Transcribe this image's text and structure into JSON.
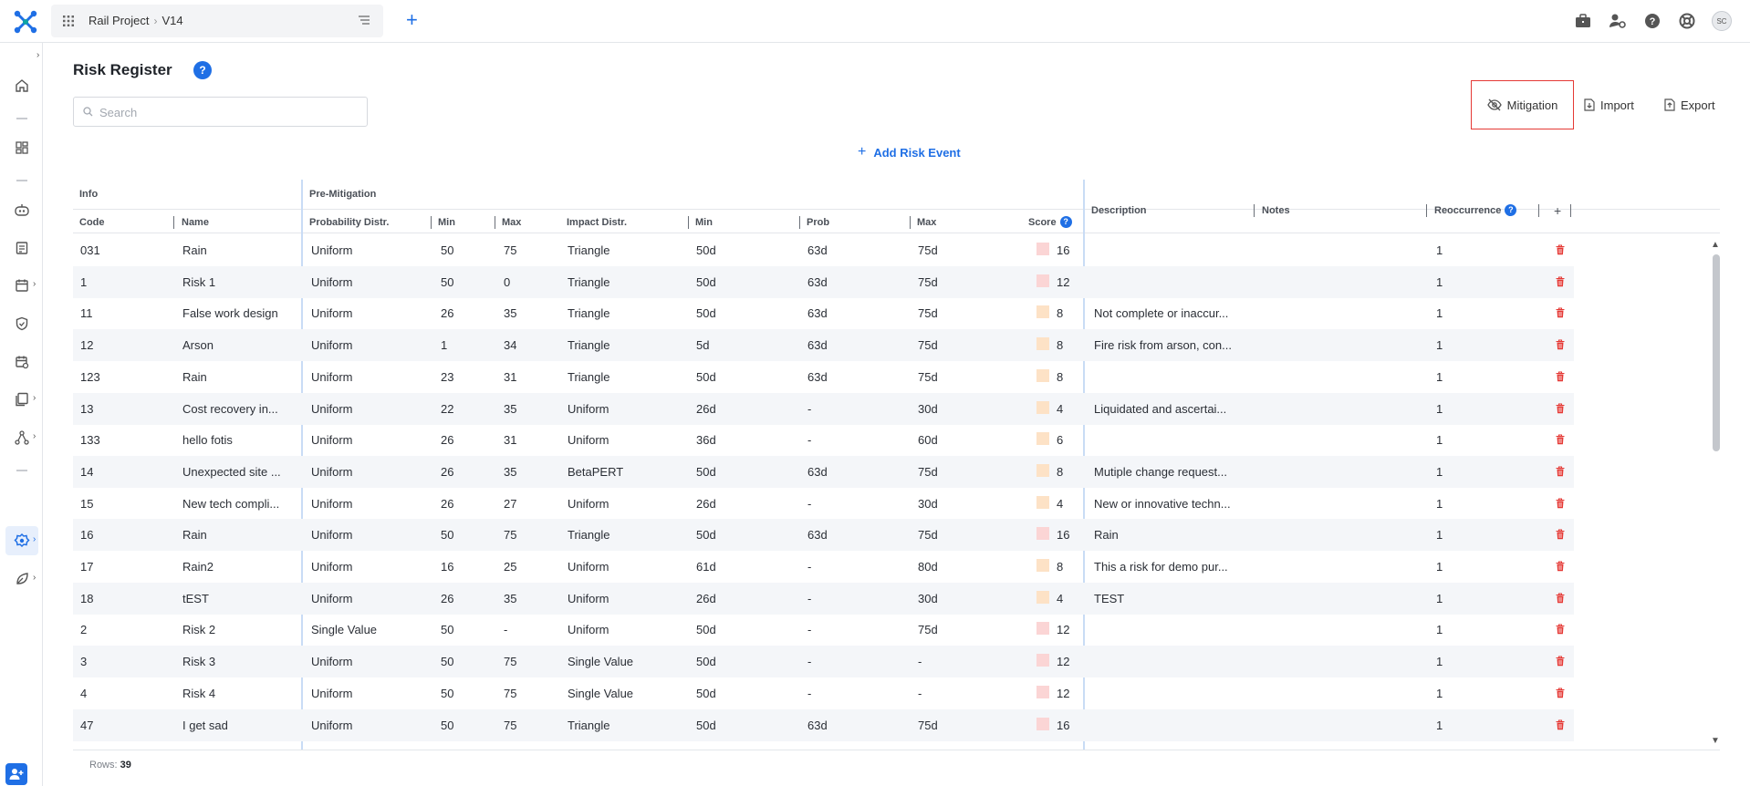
{
  "topbar": {
    "project": "Rail Project",
    "version": "V14",
    "avatar_initials": "SC"
  },
  "page": {
    "title": "Risk Register",
    "help_label": "?",
    "search_placeholder": "Search"
  },
  "actions": {
    "mitigation": "Mitigation",
    "import": "Import",
    "export": "Export",
    "add_risk": "Add Risk Event"
  },
  "table": {
    "group_info": "Info",
    "group_pre": "Pre-Mitigation",
    "columns": {
      "code": "Code",
      "name": "Name",
      "prob_distr": "Probability Distr.",
      "min1": "Min",
      "max1": "Max",
      "impact_distr": "Impact Distr.",
      "min2": "Min",
      "prob": "Prob",
      "max2": "Max",
      "score": "Score",
      "score_help": "?",
      "description": "Description",
      "notes": "Notes",
      "reoccurrence": "Reoccurrence",
      "reoccurrence_help": "?",
      "add_col": "+"
    },
    "rows": [
      {
        "code": "031",
        "name": "Rain",
        "pd": "Uniform",
        "min1": "50",
        "max1": "75",
        "id": "Triangle",
        "min2": "50d",
        "prob": "63d",
        "max2": "75d",
        "score": "16",
        "level": "high",
        "desc": "",
        "notes": "",
        "reocc": "1"
      },
      {
        "code": "1",
        "name": "Risk 1",
        "pd": "Uniform",
        "min1": "50",
        "max1": "0",
        "id": "Triangle",
        "min2": "50d",
        "prob": "63d",
        "max2": "75d",
        "score": "12",
        "level": "high",
        "desc": "",
        "notes": "",
        "reocc": "1"
      },
      {
        "code": "11",
        "name": "False work design",
        "pd": "Uniform",
        "min1": "26",
        "max1": "35",
        "id": "Triangle",
        "min2": "50d",
        "prob": "63d",
        "max2": "75d",
        "score": "8",
        "level": "med",
        "desc": "Not complete or inaccur...",
        "notes": "",
        "reocc": "1"
      },
      {
        "code": "12",
        "name": "Arson",
        "pd": "Uniform",
        "min1": "1",
        "max1": "34",
        "id": "Triangle",
        "min2": "5d",
        "prob": "63d",
        "max2": "75d",
        "score": "8",
        "level": "med",
        "desc": "Fire risk from arson, con...",
        "notes": "",
        "reocc": "1"
      },
      {
        "code": "123",
        "name": "Rain",
        "pd": "Uniform",
        "min1": "23",
        "max1": "31",
        "id": "Triangle",
        "min2": "50d",
        "prob": "63d",
        "max2": "75d",
        "score": "8",
        "level": "med",
        "desc": "",
        "notes": "",
        "reocc": "1"
      },
      {
        "code": "13",
        "name": "Cost recovery in...",
        "pd": "Uniform",
        "min1": "22",
        "max1": "35",
        "id": "Uniform",
        "min2": "26d",
        "prob": "-",
        "max2": "30d",
        "score": "4",
        "level": "med",
        "desc": "Liquidated and ascertai...",
        "notes": "",
        "reocc": "1"
      },
      {
        "code": "133",
        "name": "hello fotis",
        "pd": "Uniform",
        "min1": "26",
        "max1": "31",
        "id": "Uniform",
        "min2": "36d",
        "prob": "-",
        "max2": "60d",
        "score": "6",
        "level": "med",
        "desc": "",
        "notes": "",
        "reocc": "1"
      },
      {
        "code": "14",
        "name": "Unexpected site ...",
        "pd": "Uniform",
        "min1": "26",
        "max1": "35",
        "id": "BetaPERT",
        "min2": "50d",
        "prob": "63d",
        "max2": "75d",
        "score": "8",
        "level": "med",
        "desc": "Mutiple change request...",
        "notes": "",
        "reocc": "1"
      },
      {
        "code": "15",
        "name": "New tech compli...",
        "pd": "Uniform",
        "min1": "26",
        "max1": "27",
        "id": "Uniform",
        "min2": "26d",
        "prob": "-",
        "max2": "30d",
        "score": "4",
        "level": "med",
        "desc": "New or innovative techn...",
        "notes": "",
        "reocc": "1"
      },
      {
        "code": "16",
        "name": "Rain",
        "pd": "Uniform",
        "min1": "50",
        "max1": "75",
        "id": "Triangle",
        "min2": "50d",
        "prob": "63d",
        "max2": "75d",
        "score": "16",
        "level": "high",
        "desc": "Rain",
        "notes": "",
        "reocc": "1"
      },
      {
        "code": "17",
        "name": "Rain2",
        "pd": "Uniform",
        "min1": "16",
        "max1": "25",
        "id": "Uniform",
        "min2": "61d",
        "prob": "-",
        "max2": "80d",
        "score": "8",
        "level": "med",
        "desc": "This a risk for demo pur...",
        "notes": "",
        "reocc": "1"
      },
      {
        "code": "18",
        "name": "tEST",
        "pd": "Uniform",
        "min1": "26",
        "max1": "35",
        "id": "Uniform",
        "min2": "26d",
        "prob": "-",
        "max2": "30d",
        "score": "4",
        "level": "med",
        "desc": "TEST",
        "notes": "",
        "reocc": "1"
      },
      {
        "code": "2",
        "name": "Risk 2",
        "pd": "Single Value",
        "min1": "50",
        "max1": "-",
        "id": "Uniform",
        "min2": "50d",
        "prob": "-",
        "max2": "75d",
        "score": "12",
        "level": "high",
        "desc": "",
        "notes": "",
        "reocc": "1"
      },
      {
        "code": "3",
        "name": "Risk 3",
        "pd": "Uniform",
        "min1": "50",
        "max1": "75",
        "id": "Single Value",
        "min2": "50d",
        "prob": "-",
        "max2": "-",
        "score": "12",
        "level": "high",
        "desc": "",
        "notes": "",
        "reocc": "1"
      },
      {
        "code": "4",
        "name": "Risk 4",
        "pd": "Uniform",
        "min1": "50",
        "max1": "75",
        "id": "Single Value",
        "min2": "50d",
        "prob": "-",
        "max2": "-",
        "score": "12",
        "level": "high",
        "desc": "",
        "notes": "",
        "reocc": "1"
      },
      {
        "code": "47",
        "name": "I get sad",
        "pd": "Uniform",
        "min1": "50",
        "max1": "75",
        "id": "Triangle",
        "min2": "50d",
        "prob": "63d",
        "max2": "75d",
        "score": "16",
        "level": "high",
        "desc": "",
        "notes": "",
        "reocc": "1"
      }
    ],
    "level_colors": {
      "high": "#fbd5d5",
      "med": "#fde2c6"
    },
    "trash_color": "#e53935"
  },
  "footer": {
    "rows_label": "Rows:",
    "rows_count": "39"
  }
}
